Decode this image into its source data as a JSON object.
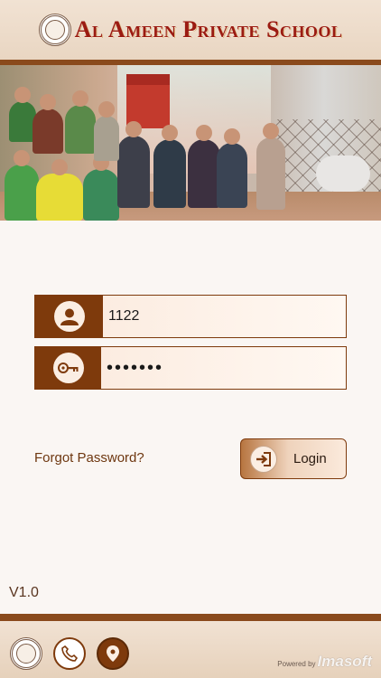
{
  "header": {
    "school_name": "Al Ameen Private School"
  },
  "login": {
    "username_value": "1122",
    "password_value": "•••••••",
    "forgot_password_label": "Forgot Password?",
    "login_button_label": "Login"
  },
  "version": "V1.0",
  "footer": {
    "powered_by": "Powered by",
    "brand": "Imasoft"
  },
  "colors": {
    "accent": "#7e3a0c",
    "title": "#9b1b12",
    "header_bg": "#f1e2d3"
  },
  "icons": [
    "school-logo-icon",
    "user-icon",
    "key-icon",
    "login-arrow-icon",
    "phone-icon",
    "map-pin-icon"
  ]
}
